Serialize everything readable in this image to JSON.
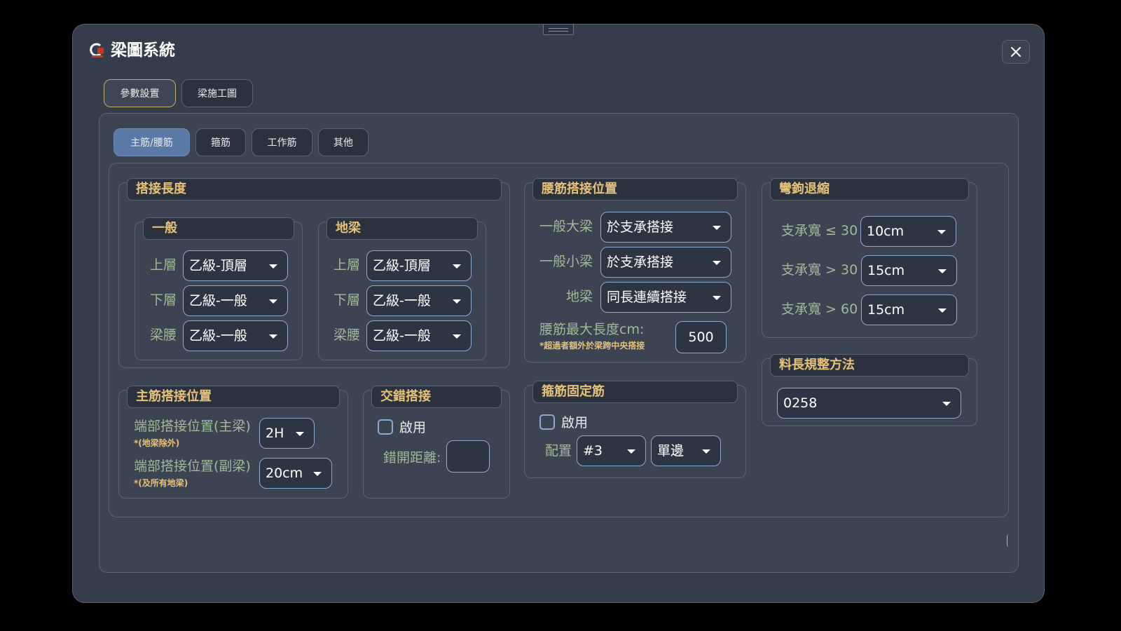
{
  "app": {
    "title": "梁圖系統",
    "logo_icon": "app-logo-icon",
    "close_icon": "close-icon"
  },
  "outer_tabs": [
    {
      "label": "參數設置",
      "active": true
    },
    {
      "label": "梁施工圖",
      "active": false
    }
  ],
  "inner_tabs": [
    {
      "label": "主筋/腰筋",
      "active": true
    },
    {
      "label": "箍筋",
      "active": false
    },
    {
      "label": "工作筋",
      "active": false
    },
    {
      "label": "其他",
      "active": false
    }
  ],
  "lap_length": {
    "title": "搭接長度",
    "general": {
      "title": "一般",
      "rows": [
        {
          "label": "上層",
          "value": "乙級-頂層"
        },
        {
          "label": "下層",
          "value": "乙級-一般"
        },
        {
          "label": "梁腰",
          "value": "乙級-一般"
        }
      ]
    },
    "ground_beam": {
      "title": "地梁",
      "rows": [
        {
          "label": "上層",
          "value": "乙級-頂層"
        },
        {
          "label": "下層",
          "value": "乙級-一般"
        },
        {
          "label": "梁腰",
          "value": "乙級-一般"
        }
      ]
    }
  },
  "waist_lap": {
    "title": "腰筋搭接位置",
    "rows": [
      {
        "label": "一般大梁",
        "value": "於支承搭接"
      },
      {
        "label": "一般小梁",
        "value": "於支承搭接"
      },
      {
        "label": "地梁",
        "value": "同長連續搭接"
      }
    ],
    "max_length_label": "腰筋最大長度cm:",
    "max_length_note": "*超過者額外於梁跨中央搭接",
    "max_length_value": "500"
  },
  "hook": {
    "title": "彎鉤退縮",
    "rows": [
      {
        "label": "支承寬 ≤ 30",
        "value": "10cm"
      },
      {
        "label": "支承寬 > 30",
        "value": "15cm"
      },
      {
        "label": "支承寬 > 60",
        "value": "15cm"
      }
    ]
  },
  "main_lap": {
    "title": "主筋搭接位置",
    "rows": [
      {
        "label": "端部搭接位置(主梁)",
        "note": "*(地梁除外)",
        "value": "2H"
      },
      {
        "label": "端部搭接位置(副梁)",
        "note": "*(及所有地梁)",
        "value": "20cm"
      }
    ]
  },
  "staggered": {
    "title": "交錯搭接",
    "enable_label": "啟用",
    "enabled": false,
    "offset_label": "錯開距離:",
    "offset_value": ""
  },
  "stirrup_fix": {
    "title": "箍筋固定筋",
    "enable_label": "啟用",
    "enabled": false,
    "config_label": "配置",
    "bar_value": "#3",
    "side_value": "單邊"
  },
  "length_method": {
    "title": "料長規整方法",
    "value": "0258"
  }
}
